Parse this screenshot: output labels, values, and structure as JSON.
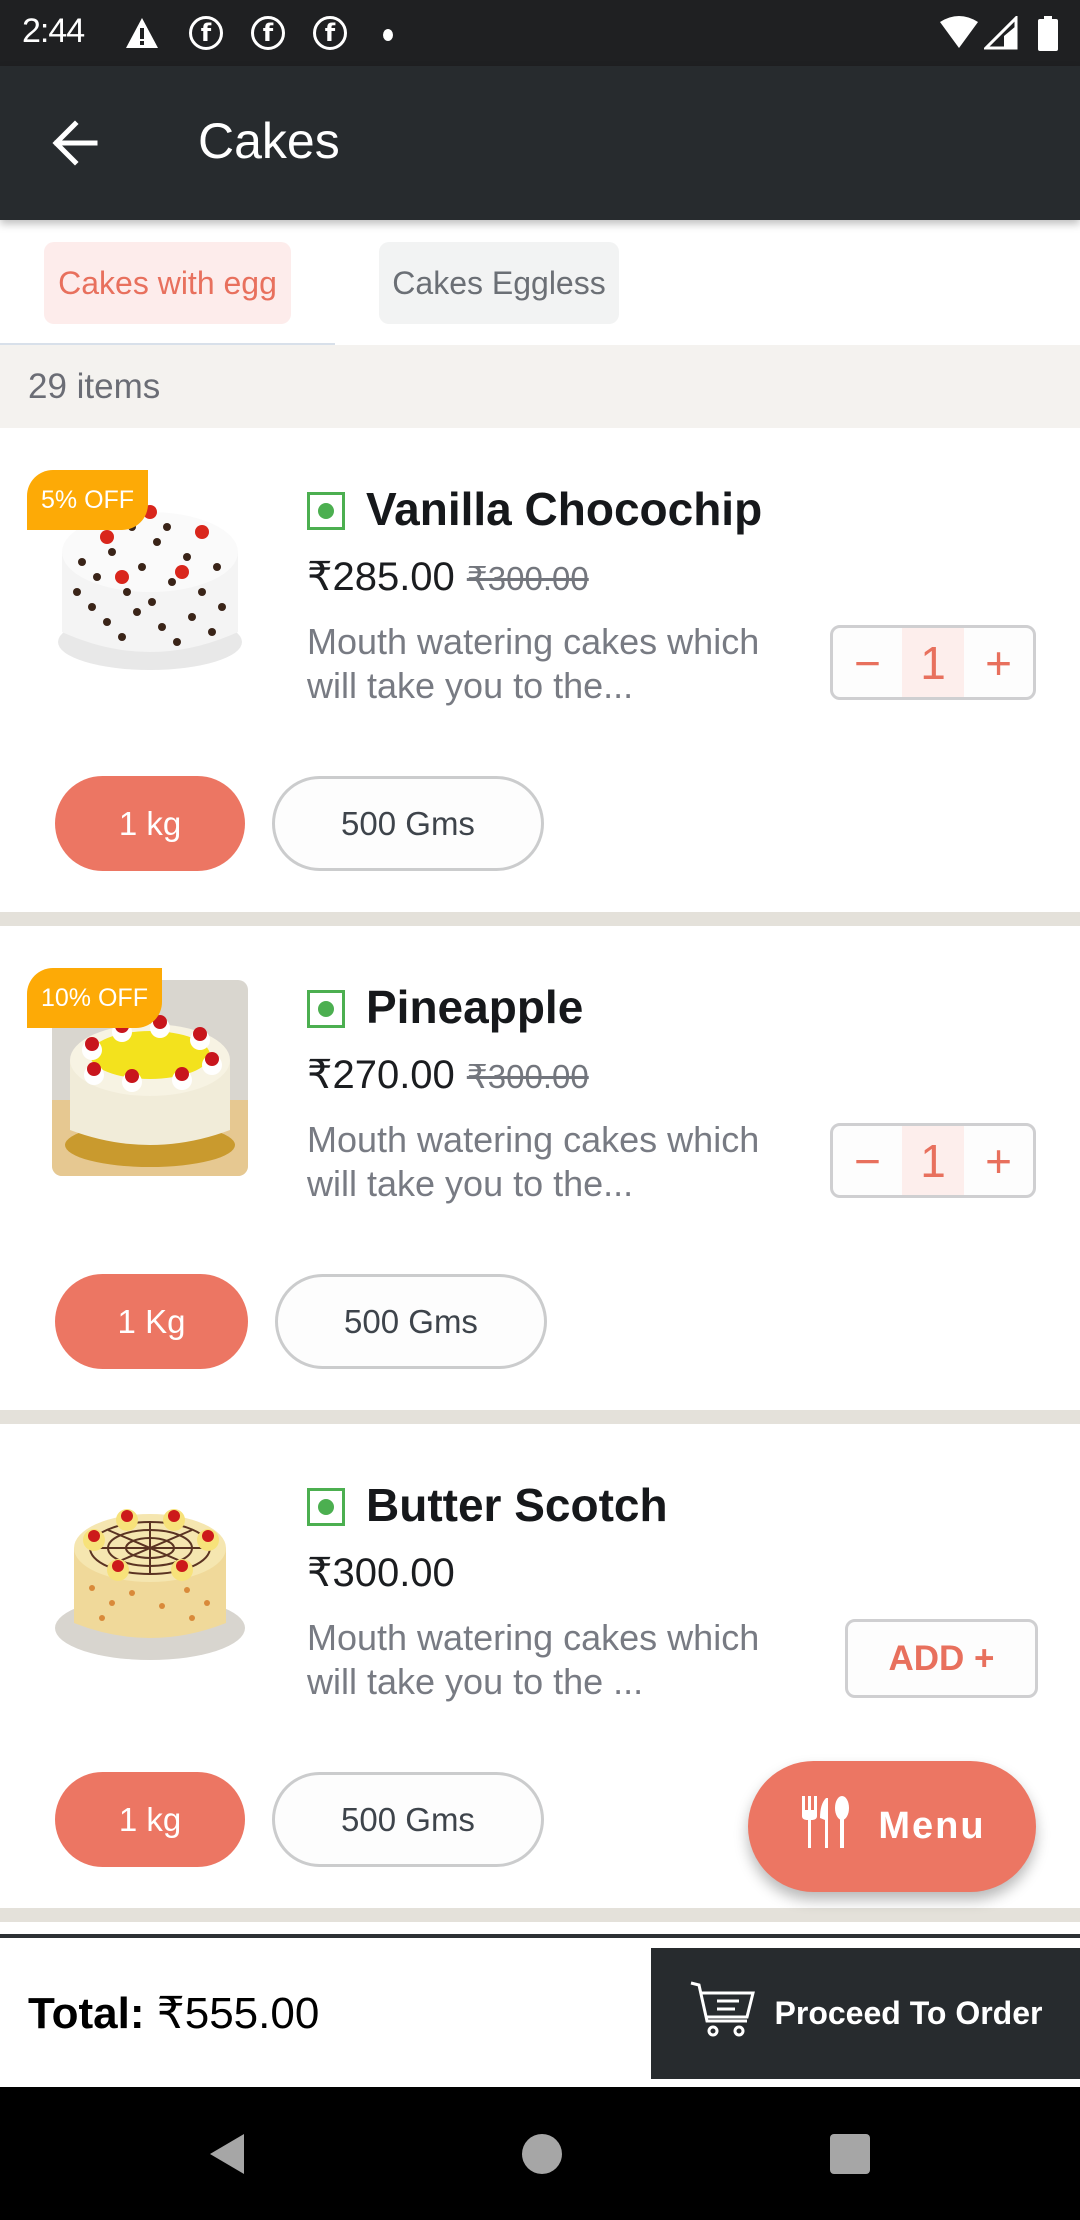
{
  "status_bar": {
    "time": "2:44",
    "icons": [
      "warning-icon",
      "facebook-icon",
      "facebook-icon",
      "facebook-icon",
      "dot-icon",
      "wifi-icon",
      "signal-icon",
      "battery-icon"
    ]
  },
  "app_bar": {
    "back_icon": "arrow-left-icon",
    "title": "Cakes"
  },
  "tabs": [
    {
      "label": "Cakes with egg",
      "selected": true
    },
    {
      "label": "Cakes Eggless",
      "selected": false
    }
  ],
  "item_count": "29 items",
  "products": [
    {
      "badge": "5% OFF",
      "veg": true,
      "name": "Vanilla Chocochip",
      "price": "₹285.00",
      "mrp": "₹300.00",
      "description": "Mouth watering cakes which will take you to the...",
      "quantity": "1",
      "sizes": [
        {
          "label": "1 kg",
          "selected": true
        },
        {
          "label": "500 Gms",
          "selected": false
        }
      ],
      "image_icon": "chocochip-cake-image"
    },
    {
      "badge": "10% OFF",
      "veg": true,
      "name": "Pineapple",
      "price": "₹270.00",
      "mrp": "₹300.00",
      "description": "Mouth watering cakes which will take you to the...",
      "quantity": "1",
      "sizes": [
        {
          "label": "1 Kg",
          "selected": true
        },
        {
          "label": "500 Gms",
          "selected": false
        }
      ],
      "image_icon": "pineapple-cake-image"
    },
    {
      "badge": "",
      "veg": true,
      "name": "Butter Scotch",
      "price": "₹300.00",
      "mrp": "",
      "description": "Mouth watering cakes which will take you to the ...",
      "add_label": "ADD +",
      "sizes": [
        {
          "label": "1 kg",
          "selected": true
        },
        {
          "label": "500 Gms",
          "selected": false
        }
      ],
      "image_icon": "butterscotch-cake-image"
    }
  ],
  "stepper": {
    "minus": "−",
    "plus": "+"
  },
  "menu_fab": {
    "label": "Menu",
    "icon": "cutlery-icon"
  },
  "footer": {
    "total_label": "Total:",
    "total_value": "₹555.00",
    "proceed_label": "Proceed To Order",
    "proceed_icon": "cart-icon"
  },
  "colors": {
    "accent": "#ec7663",
    "app_bar": "#272b2e",
    "badge": "#fdaa06",
    "veg": "#4caf50"
  }
}
